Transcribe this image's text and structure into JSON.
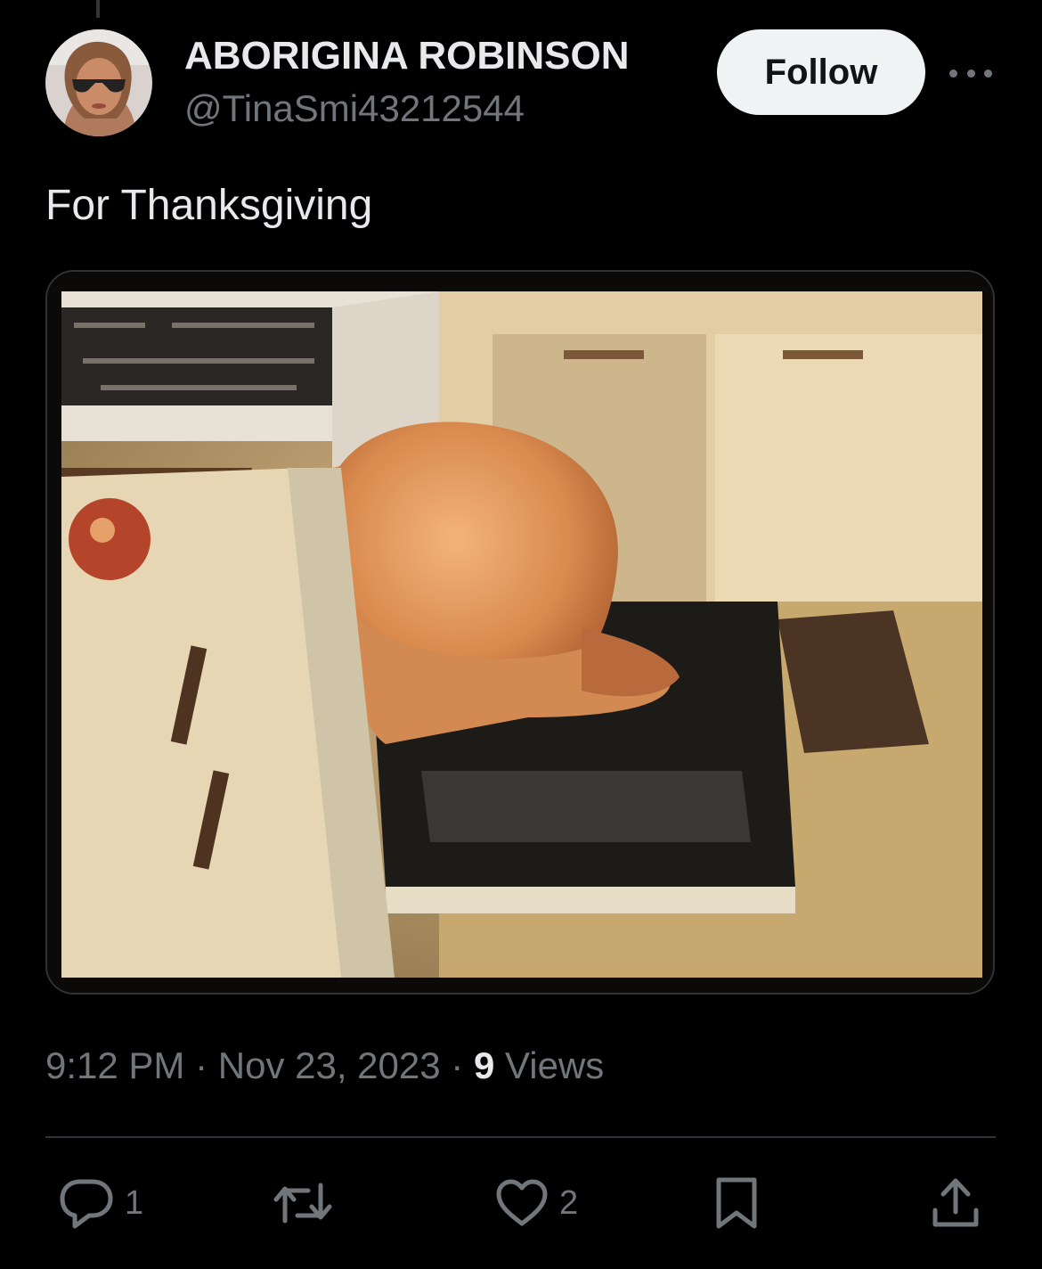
{
  "tweet": {
    "author": {
      "display_name": "ABORIGINA ROBINSON",
      "handle": "@TinaSmi43212544"
    },
    "follow_label": "Follow",
    "text": "For Thanksgiving",
    "time": "9:12 PM",
    "date": "Nov 23, 2023",
    "separator": "·",
    "views_count": "9",
    "views_label": "Views"
  },
  "actions": {
    "reply_count": "1",
    "like_count": "2"
  },
  "icons": {
    "more": "more-horizontal-icon",
    "reply": "reply-icon",
    "retweet": "retweet-icon",
    "like": "heart-icon",
    "bookmark": "bookmark-icon",
    "share": "share-icon"
  },
  "colors": {
    "background": "#000000",
    "primary_text": "#e7e9ea",
    "secondary_text": "#71767b",
    "follow_button_bg": "#eff3f4",
    "divider": "#2f3336"
  }
}
